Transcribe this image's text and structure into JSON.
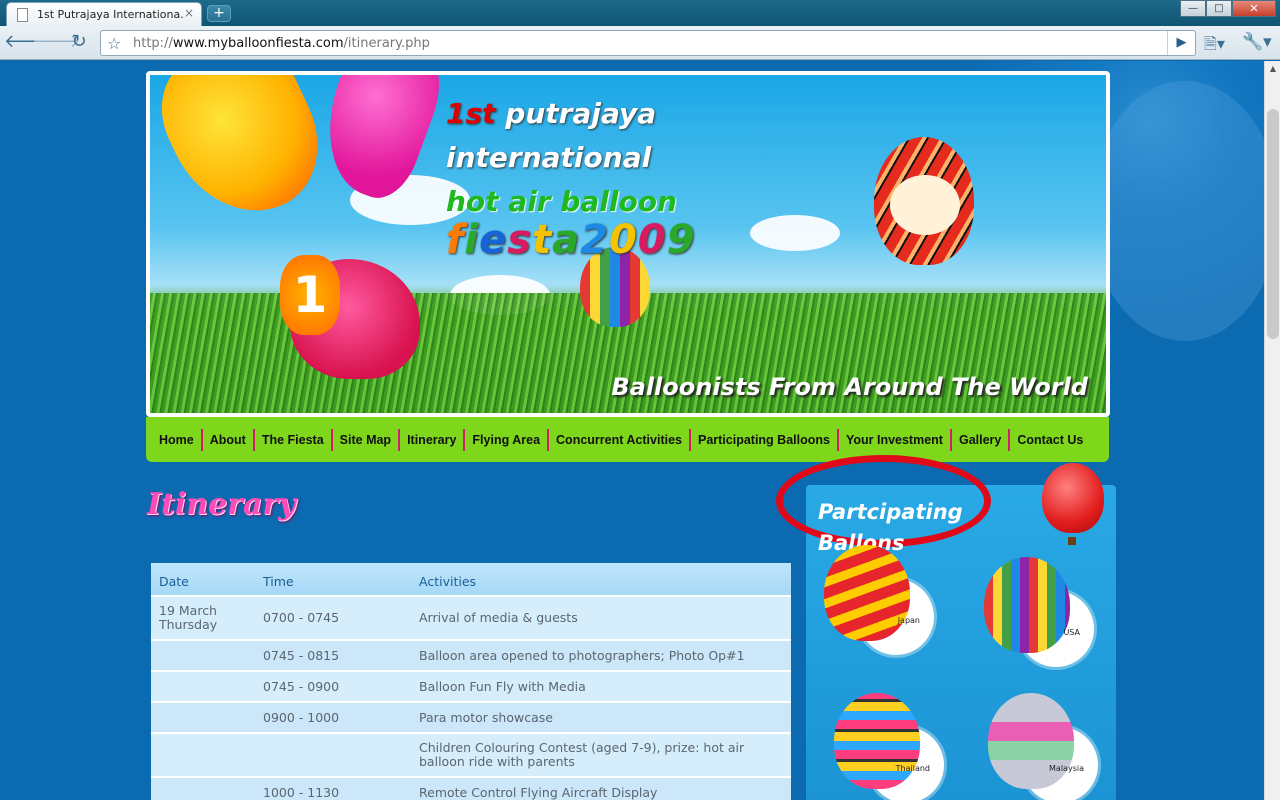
{
  "browser": {
    "tab_title": "1st Putrajaya Internationa...",
    "tab_close": "×",
    "new_tab": "+",
    "url_prefix": "http://",
    "url_host": "www.myballoonfiesta.com",
    "url_path": "/itinerary.php",
    "icons": [
      "back-icon",
      "forward-icon",
      "reload-icon",
      "star-icon",
      "go-icon",
      "page-menu-icon",
      "wrench-icon"
    ]
  },
  "banner": {
    "line1_red": "1st",
    "line1_rest": " putrajaya",
    "line2": "international",
    "line3": "hot air balloon",
    "fiesta_letters": [
      "f",
      "i",
      "e",
      "s",
      "t",
      "a",
      "2",
      "0",
      "0",
      "9"
    ],
    "fish_number": "1",
    "slogan": "Balloonists From Around The World"
  },
  "nav": {
    "items": [
      "Home",
      "About",
      "The Fiesta",
      "Site Map",
      "Itinerary",
      "Flying Area",
      "Concurrent Activities",
      "Participating Balloons",
      "Your Investment",
      "Gallery",
      "Contact Us"
    ]
  },
  "page": {
    "heading": "Itinerary"
  },
  "itinerary": {
    "headers": [
      "Date",
      "Time",
      "Activities"
    ],
    "rows": [
      {
        "date": "19 March\nThursday",
        "time": "0700 - 0745",
        "activity": "Arrival of media & guests"
      },
      {
        "date": "",
        "time": "0745 - 0815",
        "activity": "Balloon area opened to photographers; Photo Op#1"
      },
      {
        "date": "",
        "time": "0745 - 0900",
        "activity": "Balloon Fun Fly with Media"
      },
      {
        "date": "",
        "time": "0900 - 1000",
        "activity": "Para motor showcase"
      },
      {
        "date": "",
        "time": "",
        "activity": "Children Colouring Contest (aged 7-9), prize: hot air balloon ride with parents"
      },
      {
        "date": "",
        "time": "1000 - 1130",
        "activity": "Remote Control Flying Aircraft Display"
      }
    ]
  },
  "sidebar": {
    "title_line1": "Partcipating",
    "title_line2": "Ballons",
    "countries": [
      "Japan",
      "USA",
      "Thailand",
      "Malaysia"
    ]
  },
  "colors": {
    "nav_bg": "#7ed71a",
    "nav_divider": "#d21d6a",
    "heading_pink": "#ff4bb8",
    "ring_red": "#e0091a"
  }
}
